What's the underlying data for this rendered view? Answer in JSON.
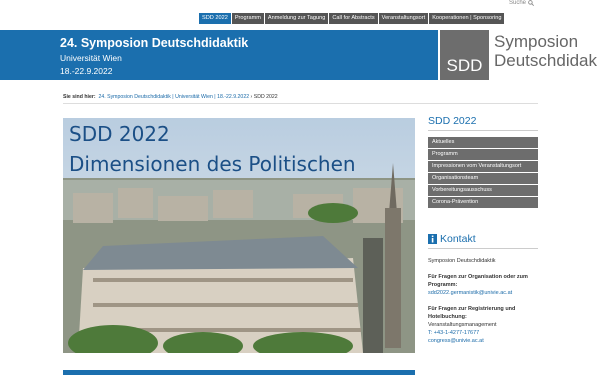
{
  "search": {
    "label": "Suche"
  },
  "nav": [
    "SDD 2022",
    "Programm",
    "Anmeldung zur Tagung",
    "Call for Abstracts",
    "Veranstaltungsort",
    "Kooperationen | Sponsoring"
  ],
  "header": {
    "title": "24. Symposion Deutschdidaktik",
    "subtitle": "Universität Wien",
    "dates": "18.-22.9.2022",
    "logo_box": "SDD",
    "logo_line1": "Symposion",
    "logo_line2": "Deutschdidak"
  },
  "breadcrumb": {
    "prefix": "Sie sind hier:",
    "link": "24. Symposion Deutschdidaktik | Universität Wien | 18.-22.9.2022",
    "sep": "›",
    "current": "SDD 2022"
  },
  "hero": {
    "line1": "SDD 2022",
    "line2": "Dimensionen des Politischen"
  },
  "sidebar": {
    "title": "SDD 2022",
    "items": [
      "Aktuelles",
      "Programm",
      "Impressionen vom Veranstaltungsort",
      "Organisationsteam",
      "Vorbereitungsausschuss",
      "Corona-Prävention"
    ]
  },
  "kontakt": {
    "title": "Kontakt",
    "org": "Symposion Deutschdidaktik",
    "q1": "Für Fragen zur Organisation oder zum Programm:",
    "email1": "sdd2022.germanistik@univie.ac.at",
    "q2": "Für Fragen zur Registrierung und Hotelbuchung:",
    "dept": "Veranstaltungsmanagement",
    "phone": "T: +43-1-4277-17677",
    "email2": "congress@univie.ac.at"
  },
  "colors": {
    "primary": "#1b6fae",
    "menu_gray": "#6d6d6d"
  }
}
